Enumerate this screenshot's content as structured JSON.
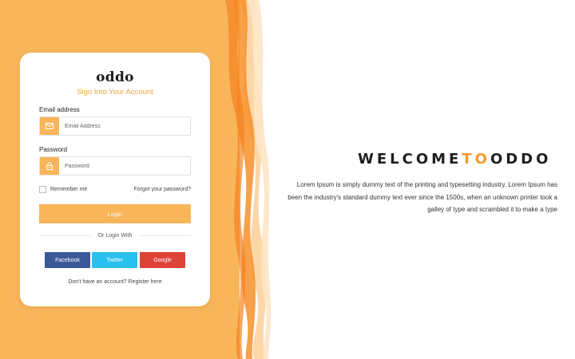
{
  "colors": {
    "accent": "#f8b55a",
    "accent_text": "#f5a33e",
    "facebook": "#3b5998",
    "twitter": "#2ac0ef",
    "google": "#dd4339"
  },
  "login_card": {
    "brand": "oddo",
    "subtitle": "Sign Into Your Account",
    "email": {
      "label": "Email address",
      "placeholder": "Email Address",
      "value": "",
      "icon": "envelope-icon"
    },
    "password": {
      "label": "Password",
      "placeholder": "Password",
      "value": "",
      "icon": "lock-icon"
    },
    "remember_label": "Remember me",
    "remember_checked": false,
    "forgot_link": "Forgot your password?",
    "login_button": "Login",
    "divider_text": "Or Login With",
    "social": {
      "facebook": "Facebook",
      "twitter": "Twitter",
      "google": "Google"
    },
    "register_text": "Don't have an account? Register here"
  },
  "hero": {
    "welcome_part1": "WELCOME",
    "welcome_part2": "TO",
    "welcome_part3": "ODDO",
    "description": "Lorem Ipsum is simply dummy text of the printing and typesetting industry. Lorem Ipsum has been the industry's standard dummy text ever since the 1500s, when an unknown printer took a galley of type and scrambled it to make a type"
  }
}
